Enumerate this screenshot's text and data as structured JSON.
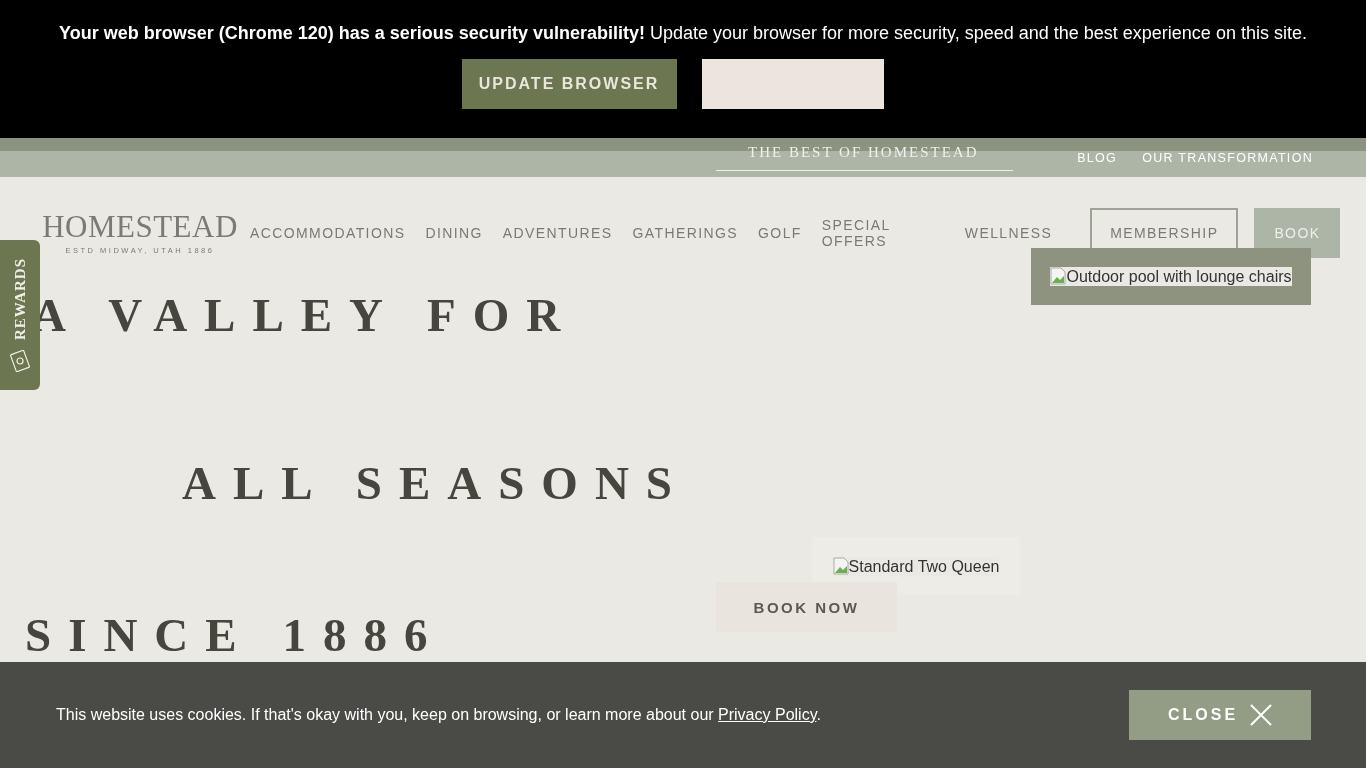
{
  "update_banner": {
    "message": "**Your web browser (Chrome 120) has a serious security vulnerability!** Update your browser for more security, speed and the best experience on this site.",
    "update_button": "UPDATE BROWSER"
  },
  "top_bar": {
    "tagline": "THE BEST OF HOMESTEAD",
    "links": [
      "BLOG",
      "OUR TRANSFORMATION"
    ]
  },
  "logo": {
    "name": "HOMESTEAD",
    "subtitle": "ESTD MIDWAY, UTAH 1886"
  },
  "nav": [
    {
      "label": "ACCOMMODATIONS",
      "kind": "link"
    },
    {
      "label": "DINING",
      "kind": "link"
    },
    {
      "label": "ADVENTURES",
      "kind": "link"
    },
    {
      "label": "GATHERINGS",
      "kind": "link"
    },
    {
      "label": "GOLF",
      "kind": "link"
    },
    {
      "label": "SPECIAL OFFERS",
      "kind": "link"
    },
    {
      "label": "WELLNESS",
      "kind": "link"
    },
    {
      "label": "MEMBERSHIP",
      "kind": "outline"
    },
    {
      "label": "BOOK",
      "kind": "filled"
    }
  ],
  "dropdown": {
    "image_alt": "Outdoor pool with lounge chairs"
  },
  "rewards_tab": {
    "label": "REWARDS"
  },
  "hero": {
    "lines": [
      "A VALLEY FOR",
      "ALL SEASONS",
      "SINCE 1886"
    ]
  },
  "room": {
    "image_alt": "Standard Two Queen",
    "button": "BOOK NOW"
  },
  "cookie_bar": {
    "text": "This website uses cookies. If that's okay with you, keep on browsing, or learn more about our",
    "link": "Privacy Policy",
    "text_after": ".",
    "close_button": "CLOSE"
  }
}
